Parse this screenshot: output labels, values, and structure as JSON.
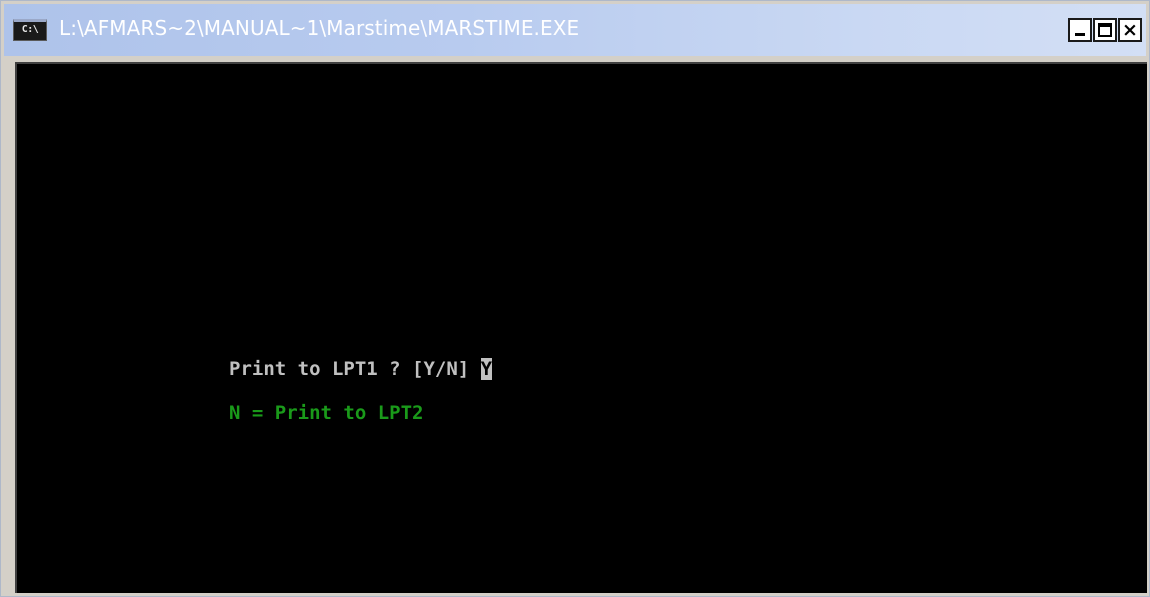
{
  "window": {
    "title": "L:\\AFMARS~2\\MANUAL~1\\Marstime\\MARSTIME.EXE",
    "icon": "console-icon",
    "icon_text": "C:\\",
    "minimize_label": "-",
    "maximize_label": "□",
    "close_label": "×"
  },
  "console": {
    "prompt_text": "Print to LPT1 ? [Y/N] ",
    "cursor_char": "Y",
    "hint_text": "N = Print to LPT2",
    "colors": {
      "background": "#000000",
      "prompt": "#c0c0c0",
      "hint": "#1a9a1a"
    }
  }
}
